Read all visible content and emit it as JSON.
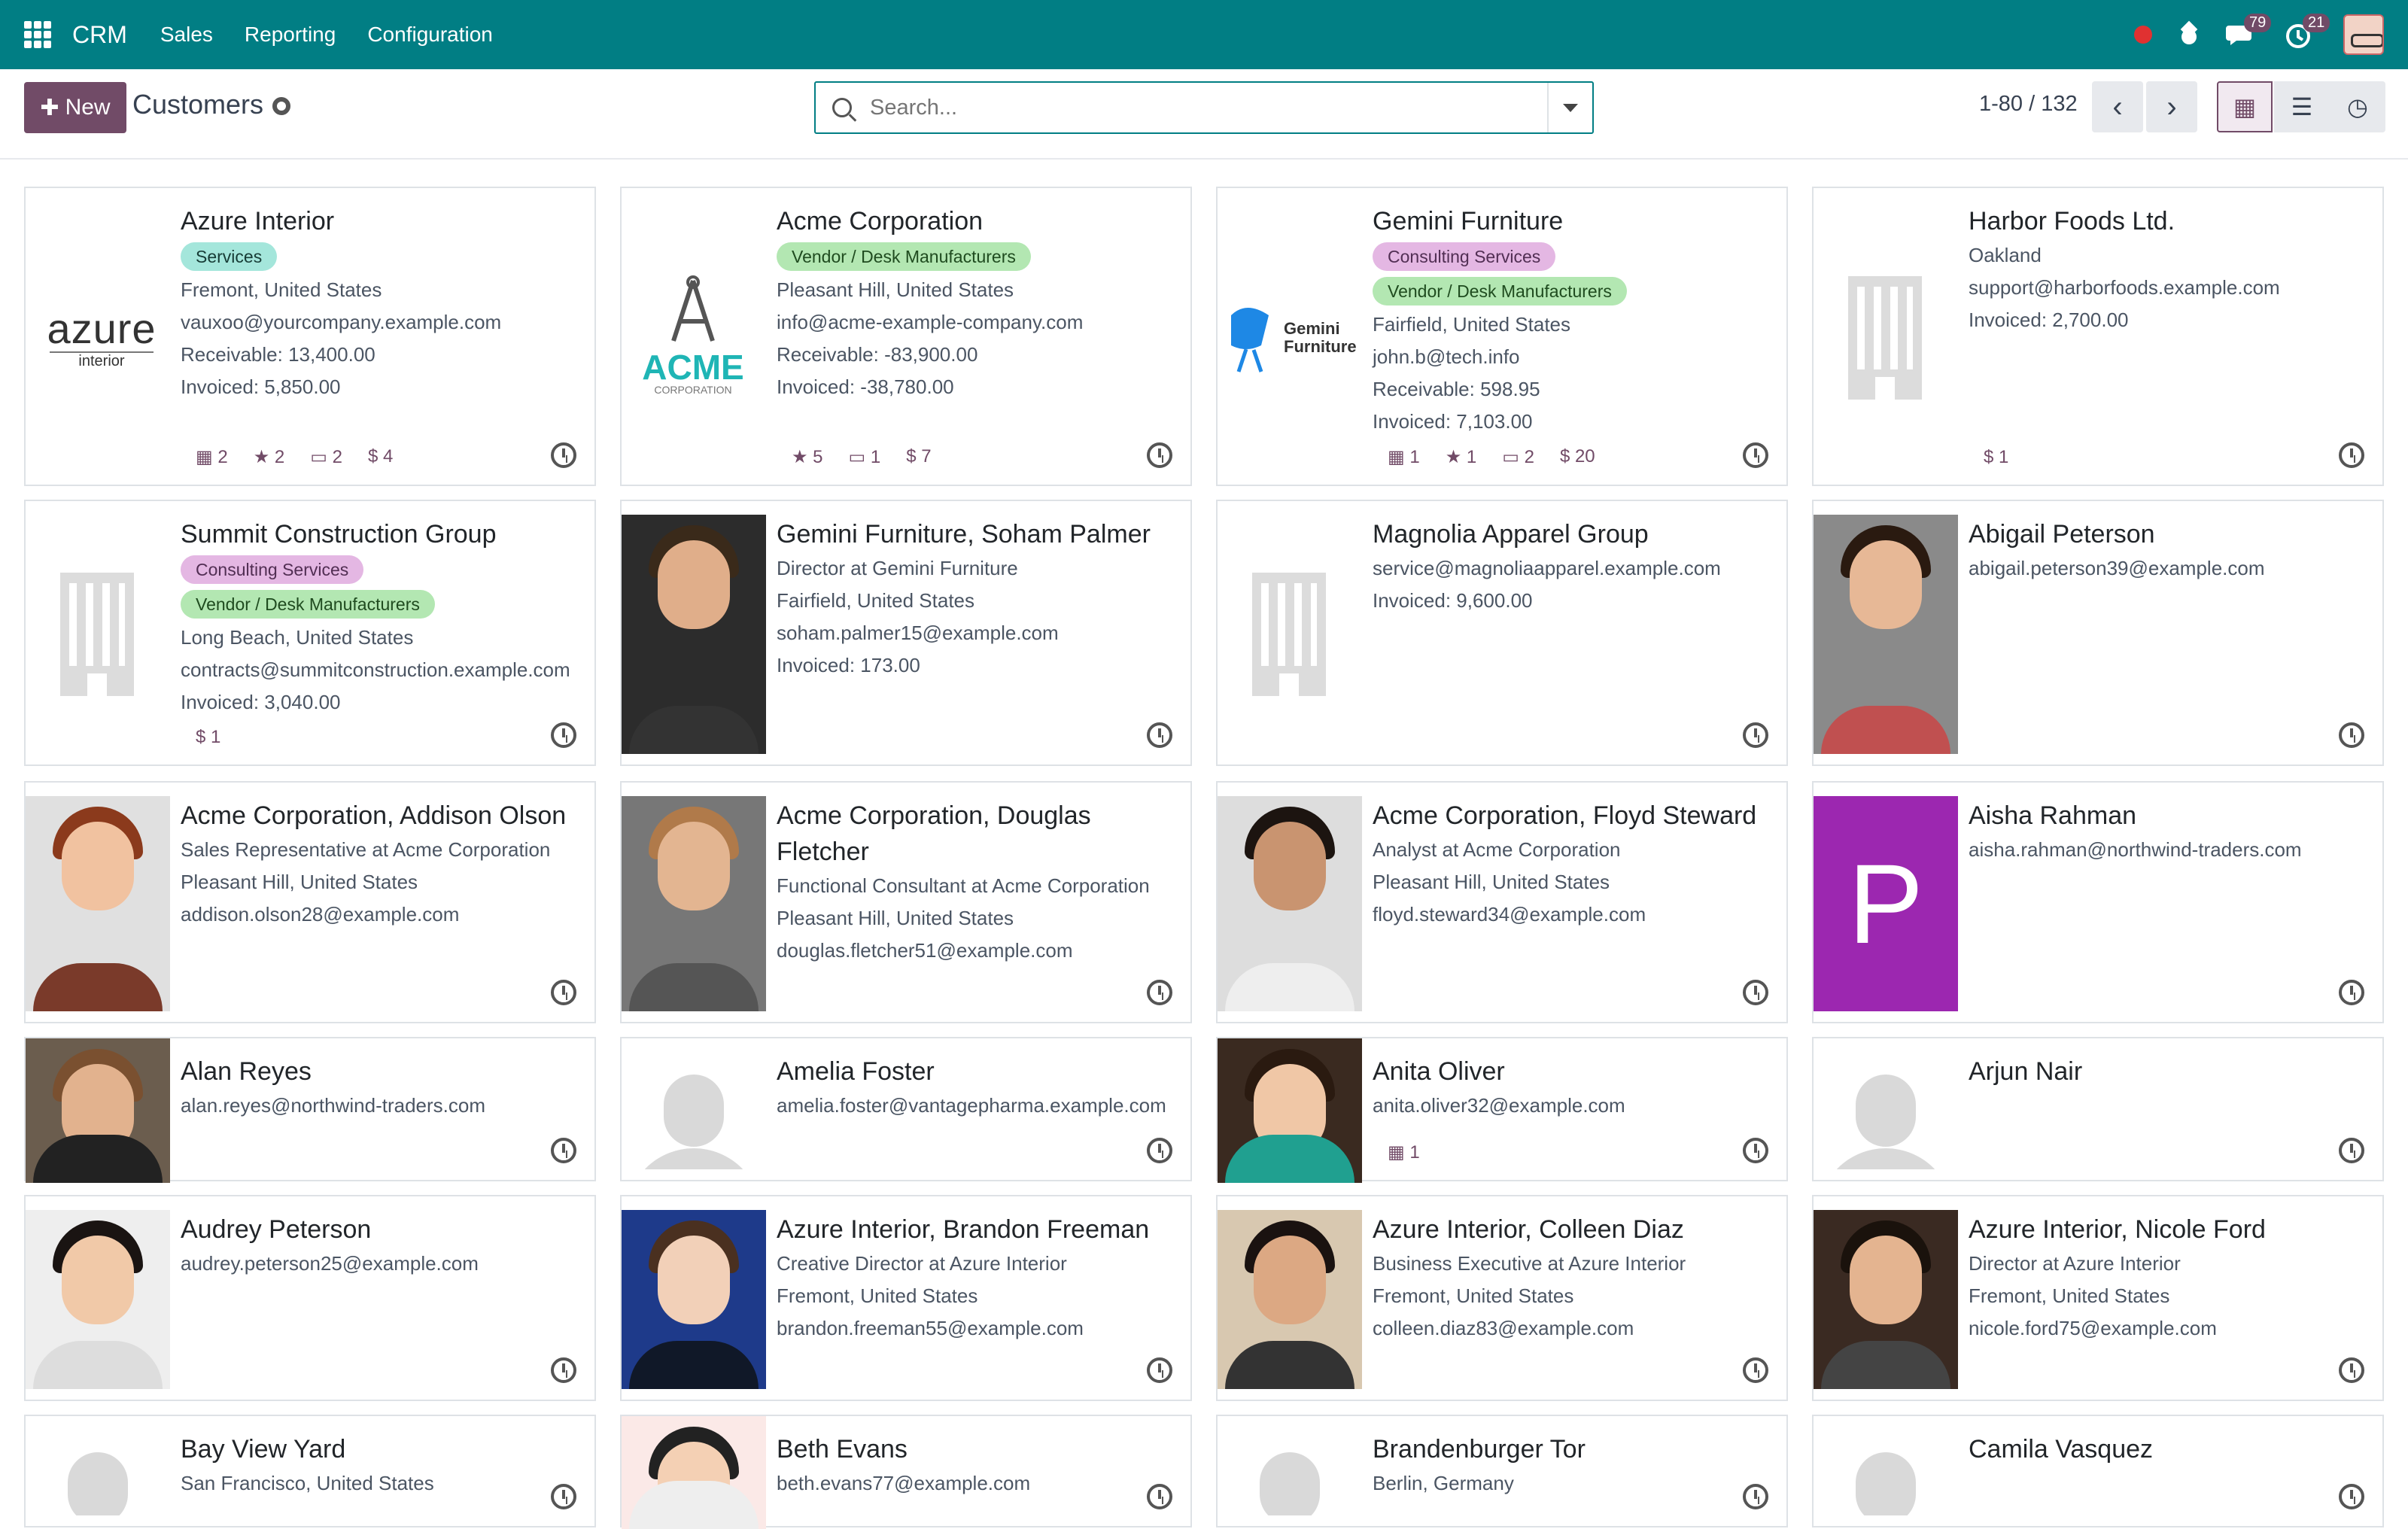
{
  "nav": {
    "app": "CRM",
    "menus": [
      "Sales",
      "Reporting",
      "Configuration"
    ],
    "messages_count": "79",
    "activities_count": "21"
  },
  "control": {
    "new_label": "New",
    "title": "Customers",
    "search_placeholder": "Search...",
    "pager": "1-80 / 132"
  },
  "colors": {
    "navbar": "#017e84",
    "primary": "#714b67"
  },
  "cards": [
    {
      "name": "Azure Interior",
      "tags": [
        {
          "label": "Services",
          "kind": "services"
        }
      ],
      "lines": [
        "Fremont, United States",
        "vauxoo@yourcompany.example.com",
        "Receivable: 13,400.00",
        "Invoiced: 5,850.00"
      ],
      "stats": [
        "2",
        "2",
        "2",
        "$ 4"
      ],
      "image": "azure-logo"
    },
    {
      "name": "Acme Corporation",
      "tags": [
        {
          "label": "Vendor / Desk Manufacturers",
          "kind": "vendor"
        }
      ],
      "lines": [
        "Pleasant Hill, United States",
        "info@acme-example-company.com",
        "Receivable: -83,900.00",
        "Invoiced: -38,780.00"
      ],
      "stats": [
        "5",
        "1",
        "$ 7"
      ],
      "image": "acme-logo"
    },
    {
      "name": "Gemini Furniture",
      "tags": [
        {
          "label": "Consulting Services",
          "kind": "consult"
        },
        {
          "label": "Vendor / Desk Manufacturers",
          "kind": "vendor"
        }
      ],
      "lines": [
        "Fairfield, United States",
        "john.b@tech.info",
        "Receivable: 598.95",
        "Invoiced: 7,103.00"
      ],
      "stats": [
        "1",
        "1",
        "2",
        "$ 20"
      ],
      "image": "gemini-logo"
    },
    {
      "name": "Harbor Foods Ltd.",
      "tags": [],
      "lines": [
        "Oakland",
        "support@harborfoods.example.com",
        "Invoiced: 2,700.00"
      ],
      "stats": [
        "$ 1"
      ],
      "image": "building"
    },
    {
      "name": "Summit Construction Group",
      "tags": [
        {
          "label": "Consulting Services",
          "kind": "consult"
        },
        {
          "label": "Vendor / Desk Manufacturers",
          "kind": "vendor"
        }
      ],
      "lines": [
        "Long Beach, United States",
        "contracts@summitconstruction.example.com",
        "Invoiced: 3,040.00"
      ],
      "stats": [
        "$ 1"
      ],
      "image": "building"
    },
    {
      "name": "Gemini Furniture, Soham Palmer",
      "tags": [],
      "lines": [
        "Director at Gemini Furniture",
        "Fairfield, United States",
        "soham.palmer15@example.com",
        "Invoiced: 173.00"
      ],
      "stats": [],
      "image": "photo"
    },
    {
      "name": "Magnolia Apparel Group",
      "tags": [],
      "lines": [
        "service@magnoliaapparel.example.com",
        "Invoiced: 9,600.00"
      ],
      "stats": [],
      "image": "building"
    },
    {
      "name": "Abigail Peterson",
      "tags": [],
      "lines": [
        "abigail.peterson39@example.com"
      ],
      "stats": [],
      "image": "photo"
    },
    {
      "name": "Acme Corporation, Addison Olson",
      "tags": [],
      "lines": [
        "Sales Representative at Acme Corporation",
        "Pleasant Hill, United States",
        "addison.olson28@example.com"
      ],
      "stats": [],
      "image": "photo"
    },
    {
      "name": "Acme Corporation, Douglas Fletcher",
      "tags": [],
      "lines": [
        "Functional Consultant at Acme Corporation",
        "Pleasant Hill, United States",
        "douglas.fletcher51@example.com"
      ],
      "stats": [],
      "image": "photo"
    },
    {
      "name": "Acme Corporation, Floyd Steward",
      "tags": [],
      "lines": [
        "Analyst at Acme Corporation",
        "Pleasant Hill, United States",
        "floyd.steward34@example.com"
      ],
      "stats": [],
      "image": "photo"
    },
    {
      "name": "Aisha Rahman",
      "tags": [],
      "lines": [
        "aisha.rahman@northwind-traders.com"
      ],
      "stats": [],
      "image": "monogram",
      "monogram": "P"
    },
    {
      "name": "Alan Reyes",
      "tags": [],
      "lines": [
        "alan.reyes@northwind-traders.com"
      ],
      "stats": [],
      "image": "photo"
    },
    {
      "name": "Amelia Foster",
      "tags": [],
      "lines": [
        "amelia.foster@vantagepharma.example.com"
      ],
      "stats": [],
      "image": "person"
    },
    {
      "name": "Anita Oliver",
      "tags": [],
      "lines": [
        "anita.oliver32@example.com"
      ],
      "stats": [
        "1"
      ],
      "image": "photo"
    },
    {
      "name": "Arjun Nair",
      "tags": [],
      "lines": [],
      "stats": [],
      "image": "person"
    },
    {
      "name": "Audrey Peterson",
      "tags": [],
      "lines": [
        "audrey.peterson25@example.com"
      ],
      "stats": [],
      "image": "photo"
    },
    {
      "name": "Azure Interior, Brandon Freeman",
      "tags": [],
      "lines": [
        "Creative Director at Azure Interior",
        "Fremont, United States",
        "brandon.freeman55@example.com"
      ],
      "stats": [],
      "image": "photo"
    },
    {
      "name": "Azure Interior, Colleen Diaz",
      "tags": [],
      "lines": [
        "Business Executive at Azure Interior",
        "Fremont, United States",
        "colleen.diaz83@example.com"
      ],
      "stats": [],
      "image": "photo"
    },
    {
      "name": "Azure Interior, Nicole Ford",
      "tags": [],
      "lines": [
        "Director at Azure Interior",
        "Fremont, United States",
        "nicole.ford75@example.com"
      ],
      "stats": [],
      "image": "photo"
    },
    {
      "name": "Bay View Yard",
      "tags": [],
      "lines": [
        "San Francisco, United States"
      ],
      "stats": [],
      "image": "person"
    },
    {
      "name": "Beth Evans",
      "tags": [],
      "lines": [
        "beth.evans77@example.com"
      ],
      "stats": [],
      "image": "photo"
    },
    {
      "name": "Brandenburger Tor",
      "tags": [],
      "lines": [
        "Berlin, Germany"
      ],
      "stats": [],
      "image": "person"
    },
    {
      "name": "Camila Vasquez",
      "tags": [],
      "lines": [],
      "stats": [],
      "image": "person"
    }
  ]
}
